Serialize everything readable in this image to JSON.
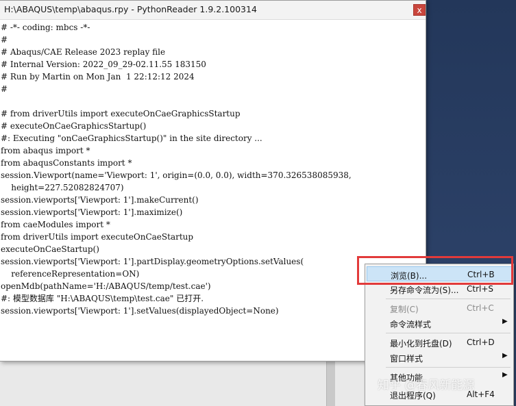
{
  "window": {
    "title": "H:\\ABAQUS\\temp\\abaqus.rpy - PythonReader 1.9.2.100314",
    "close_label": "x"
  },
  "code_lines": [
    "# -*- coding: mbcs -*-",
    "#",
    "# Abaqus/CAE Release 2023 replay file",
    "# Internal Version: 2022_09_29-02.11.55 183150",
    "# Run by Martin on Mon Jan  1 22:12:12 2024",
    "#",
    "",
    "# from driverUtils import executeOnCaeGraphicsStartup",
    "# executeOnCaeGraphicsStartup()",
    "#: Executing \"onCaeGraphicsStartup()\" in the site directory ...",
    "from abaqus import *",
    "from abaqusConstants import *",
    "session.Viewport(name='Viewport: 1', origin=(0.0, 0.0), width=370.326538085938,",
    "    height=227.52082824707)",
    "session.viewports['Viewport: 1'].makeCurrent()",
    "session.viewports['Viewport: 1'].maximize()",
    "from caeModules import *",
    "from driverUtils import executeOnCaeStartup",
    "executeOnCaeStartup()",
    "session.viewports['Viewport: 1'].partDisplay.geometryOptions.setValues(",
    "    referenceRepresentation=ON)",
    "openMdb(pathName='H:/ABAQUS/temp/test.cae')",
    "#: 模型数据库 \"H:\\ABAQUS\\temp\\test.cae\" 已打开.",
    "session.viewports['Viewport: 1'].setValues(displayedObject=None)"
  ],
  "context_menu": {
    "items": [
      {
        "label": "浏览(B)...",
        "shortcut": "Ctrl+B"
      },
      {
        "label": "另存命令流为(S)...",
        "shortcut": "Ctrl+S"
      },
      {
        "label": "复制(C)",
        "shortcut": "Ctrl+C"
      },
      {
        "label": "命令流样式",
        "shortcut": ""
      },
      {
        "label": "最小化到托盘(D)",
        "shortcut": "Ctrl+D"
      },
      {
        "label": "窗口样式",
        "shortcut": ""
      },
      {
        "label": "其他功能",
        "shortcut": ""
      },
      {
        "label": "退出程序(Q)",
        "shortcut": "Alt+F4"
      }
    ],
    "highlight_color": "#cce4f7",
    "annotation_color": "#e23a3a"
  },
  "watermark": "知乎 @春风新能源"
}
